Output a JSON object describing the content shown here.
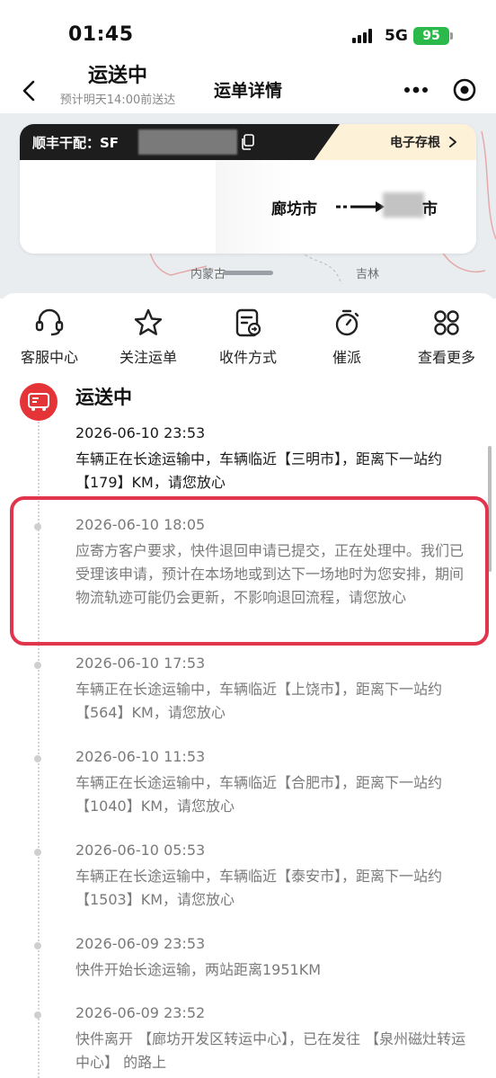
{
  "status_bar": {
    "time": "01:45",
    "network": "5G",
    "battery": "95"
  },
  "nav": {
    "title": "运单详情"
  },
  "map": {
    "labels": [
      "内蒙古",
      "吉林"
    ]
  },
  "card": {
    "waybill_label": "顺丰干配：SF",
    "e_record_label": "电子存根",
    "status": "运送中",
    "eta": "预计明天14:00前送达",
    "origin": "廊坊市",
    "destination_suffix": "市"
  },
  "quick_actions": [
    {
      "label": "客服中心",
      "icon": "headset-icon"
    },
    {
      "label": "关注运单",
      "icon": "star-icon"
    },
    {
      "label": "收件方式",
      "icon": "receive-method-icon"
    },
    {
      "label": "催派",
      "icon": "stopwatch-icon"
    },
    {
      "label": "查看更多",
      "icon": "grid-more-icon"
    }
  ],
  "timeline": {
    "status": "运送中",
    "events": [
      {
        "time": "2026-06-10 23:53",
        "text": "车辆正在长途运输中，车辆临近【三明市】，距离下一站约【179】KM，请您放心"
      },
      {
        "time": "2026-06-10 18:05",
        "text": "应寄方客户要求，快件退回申请已提交，正在处理中。我们已受理该申请，预计在本场地或到达下一场地时为您安排，期间物流轨迹可能仍会更新，不影响退回流程，请您放心"
      },
      {
        "time": "2026-06-10 17:53",
        "text": "车辆正在长途运输中，车辆临近【上饶市】，距离下一站约【564】KM，请您放心"
      },
      {
        "time": "2026-06-10 11:53",
        "text": "车辆正在长途运输中，车辆临近【合肥市】，距离下一站约【1040】KM，请您放心"
      },
      {
        "time": "2026-06-10 05:53",
        "text": "车辆正在长途运输中，车辆临近【泰安市】，距离下一站约【1503】KM，请您放心"
      },
      {
        "time": "2026-06-09 23:53",
        "text": "快件开始长途运输，两站距离1951KM"
      },
      {
        "time": "2026-06-09 23:52",
        "text": "快件离开 【廊坊开发区转运中心】，已在发往 【泉州磁灶转运中心】 的路上"
      }
    ]
  },
  "colors": {
    "accent_red": "#e53437",
    "highlight_border": "#e1344d",
    "battery_green": "#2bb94a"
  }
}
